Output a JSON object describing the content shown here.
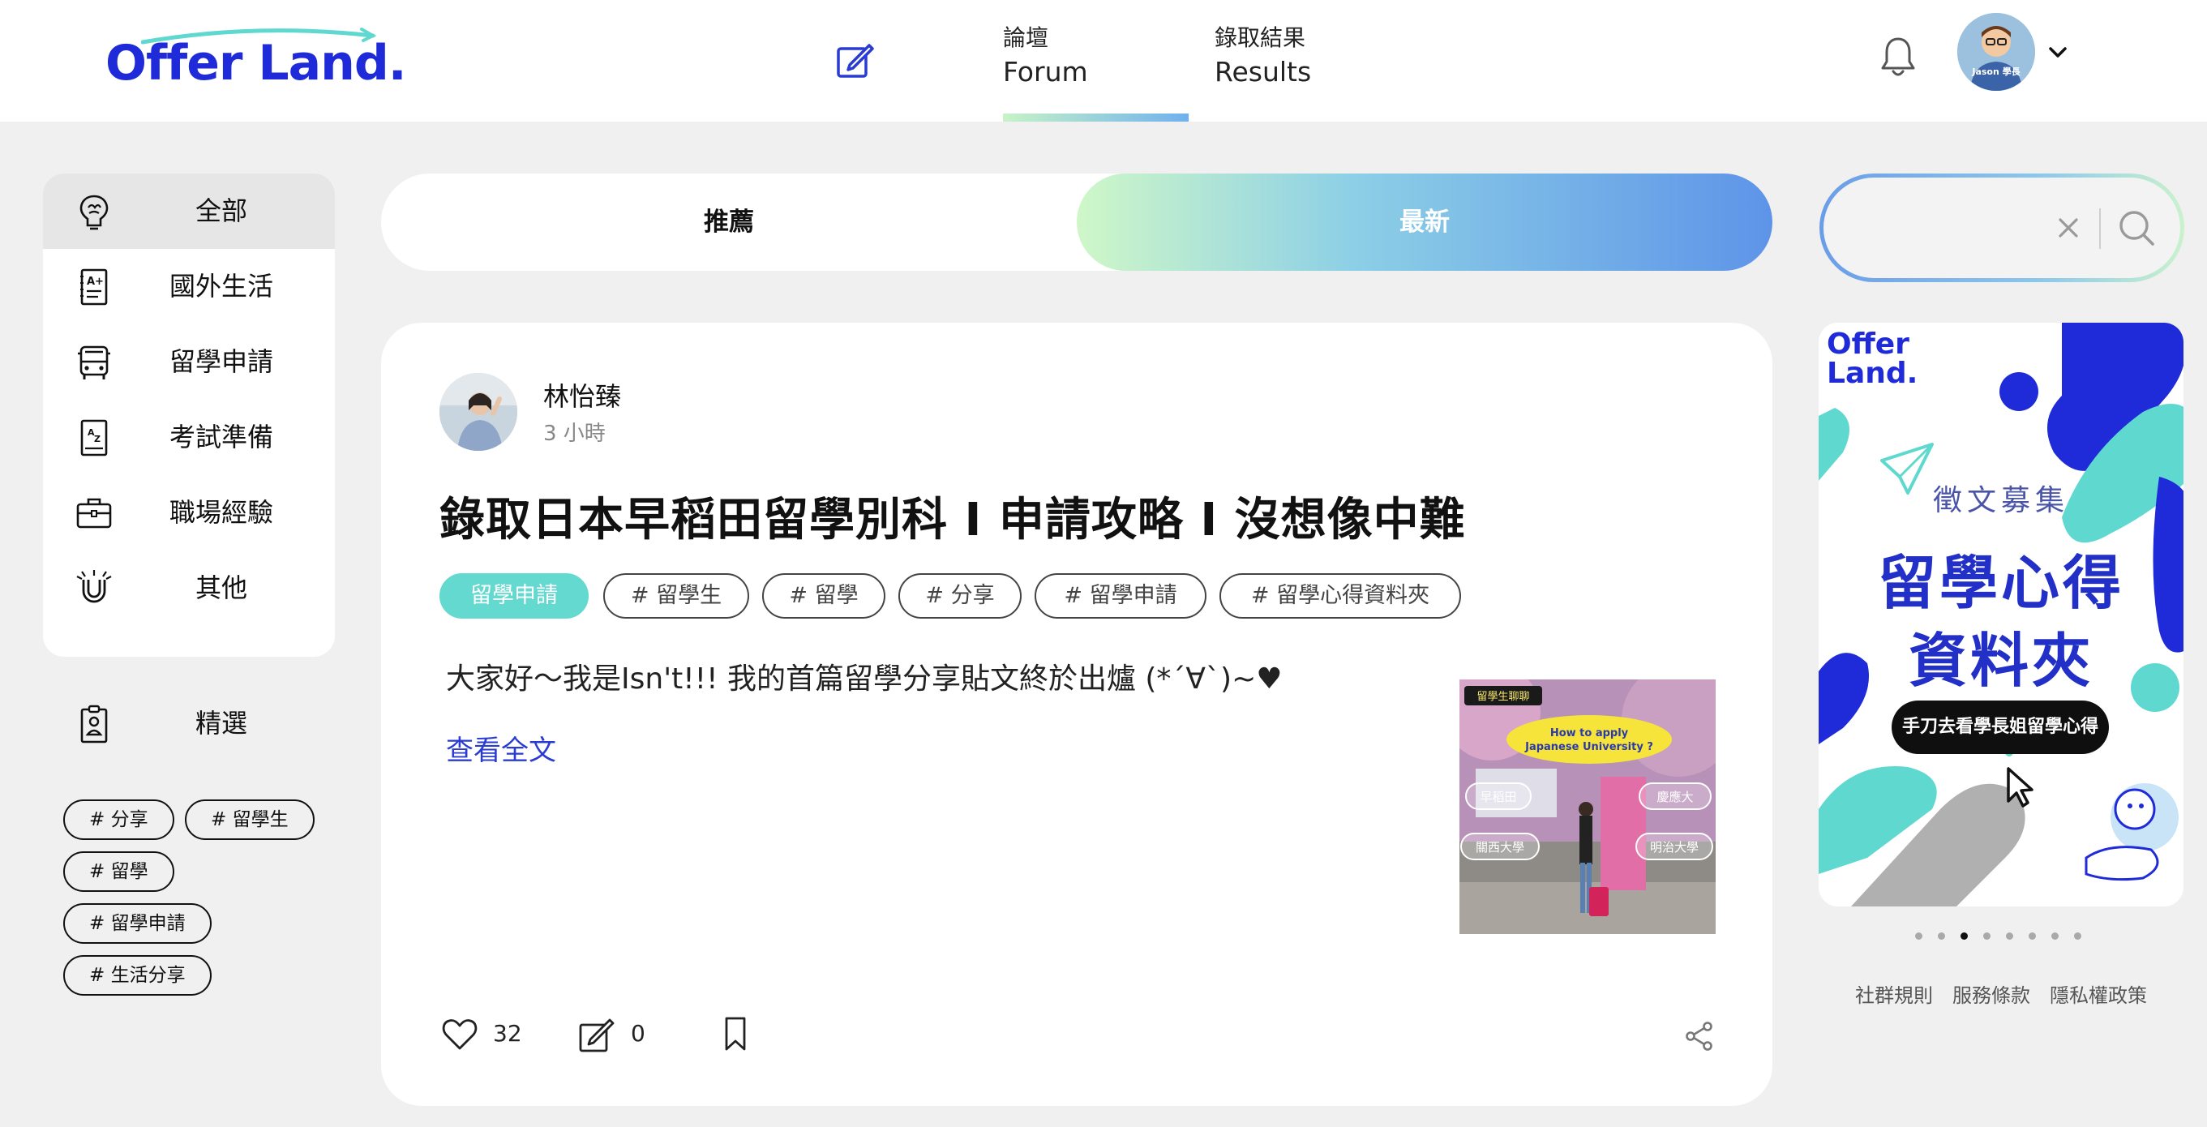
{
  "header": {
    "logo_text": "Offer Land.",
    "nav": [
      {
        "zh": "論壇",
        "en": "Forum",
        "active": true
      },
      {
        "zh": "錄取結果",
        "en": "Results",
        "active": false
      }
    ],
    "avatar_badge": "Jason 學長"
  },
  "sidebar": {
    "categories": [
      {
        "label": "全部",
        "icon": "brain-bulb-icon",
        "active": true
      },
      {
        "label": "國外生活",
        "icon": "grade-document-icon",
        "active": false
      },
      {
        "label": "留學申請",
        "icon": "bus-icon",
        "active": false
      },
      {
        "label": "考試準備",
        "icon": "az-book-icon",
        "active": false
      },
      {
        "label": "職場經驗",
        "icon": "briefcase-icon",
        "active": false
      },
      {
        "label": "其他",
        "icon": "magnet-icon",
        "active": false
      }
    ],
    "featured_label": "精選",
    "tags": [
      "# 分享",
      "# 留學生",
      "# 留學",
      "# 留學申請",
      "# 生活分享"
    ]
  },
  "sort": {
    "recommended": "推薦",
    "latest": "最新",
    "active": "latest"
  },
  "post": {
    "author": "林怡臻",
    "time": "3 小時",
    "title": "錄取日本早稻田留學別科 I 申請攻略 I 沒想像中難",
    "category_chip": "留學申請",
    "tags": [
      "# 留學生",
      "# 留學",
      "# 分享",
      "# 留學申請",
      "# 留學心得資料夾"
    ],
    "excerpt": "大家好～我是Isn't!!! 我的首篇留學分享貼文終於出爐 (*´∀`)~♥",
    "read_more": "查看全文",
    "likes": "32",
    "comments": "0",
    "thumbnail": {
      "badge": "留學生聊聊",
      "bubble_line1": "How to apply",
      "bubble_line2": "Japanese University ?",
      "labels": [
        "早稻田",
        "慶應大",
        "關西大學",
        "明治大學"
      ]
    }
  },
  "search": {
    "placeholder": ""
  },
  "banner": {
    "logo_line1": "Offer",
    "logo_line2": "Land.",
    "subtitle": "徵文募集",
    "title_line1": "留學心得",
    "title_line2": "資料夾",
    "cta": "手刀去看學長姐留學心得",
    "dot_count": 8,
    "active_dot": 2
  },
  "footer": {
    "links": [
      "社群規則",
      "服務條款",
      "隱私權政策"
    ]
  },
  "colors": {
    "brand_blue": "#1f2bd8",
    "teal_chip": "#63d9d0",
    "link_blue": "#2a3bd2"
  }
}
